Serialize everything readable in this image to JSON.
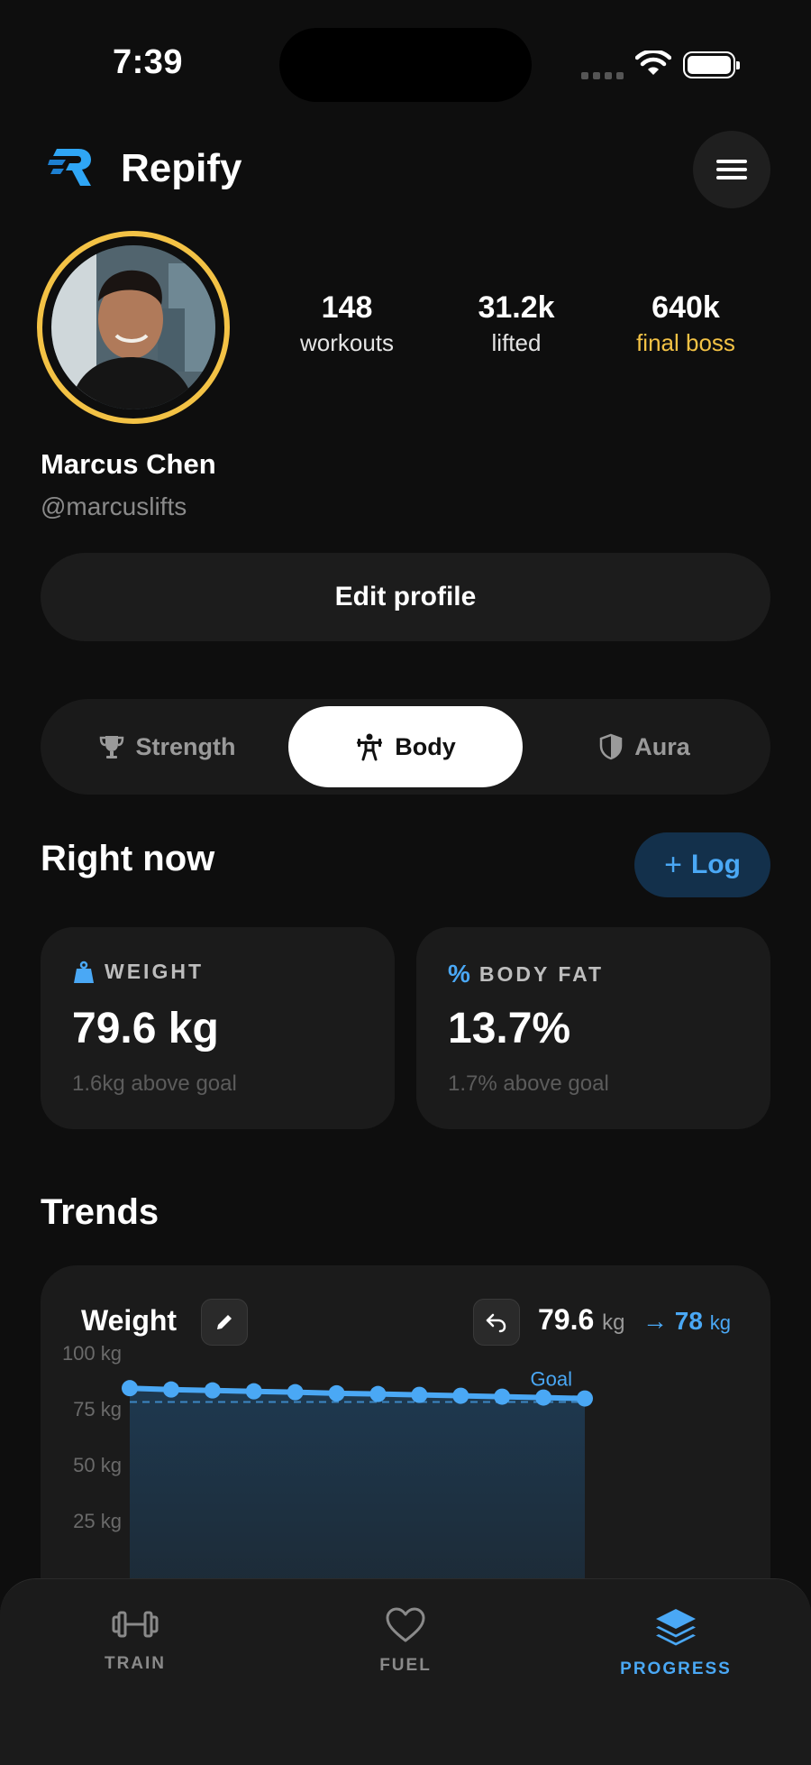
{
  "status_bar": {
    "time": "7:39"
  },
  "header": {
    "app_name": "Repify",
    "logo_icon": "repify-logo-icon",
    "menu_icon": "hamburger-menu-icon"
  },
  "profile": {
    "name": "Marcus Chen",
    "handle": "@marcuslifts",
    "stats": [
      {
        "value": "148",
        "label": "workouts"
      },
      {
        "value": "31.2k",
        "label": "lifted"
      },
      {
        "value": "640k",
        "label": "final boss"
      }
    ],
    "edit_label": "Edit profile"
  },
  "tabs": [
    {
      "label": "Strength",
      "icon": "trophy-icon",
      "active": false
    },
    {
      "label": "Body",
      "icon": "weightlifter-icon",
      "active": true
    },
    {
      "label": "Aura",
      "icon": "shield-icon",
      "active": false
    }
  ],
  "right_now": {
    "title": "Right now",
    "log_label": "Log",
    "cards": [
      {
        "label": "WEIGHT",
        "value": "79.6 kg",
        "sub": "1.6kg above goal",
        "icon": "weight-icon"
      },
      {
        "label": "BODY FAT",
        "value": "13.7%",
        "sub": "1.7% above goal",
        "icon": "percent-icon"
      }
    ]
  },
  "trends": {
    "title": "Trends",
    "card_title": "Weight",
    "current_value": "79.6",
    "current_unit": "kg",
    "goal_value": "78",
    "goal_unit": "kg",
    "goal_label": "Goal",
    "y_ticks": [
      "100 kg",
      "75 kg",
      "50 kg",
      "25 kg"
    ]
  },
  "chart_data": {
    "type": "area",
    "y_ticks": [
      100,
      75,
      50,
      25
    ],
    "goal": 78,
    "values": [
      84.2,
      83.6,
      83.2,
      82.8,
      82.4,
      81.9,
      81.6,
      81.2,
      80.8,
      80.4,
      80.0,
      79.6
    ],
    "colors": {
      "line": "#4aa8f5",
      "fill": "#1e3a52"
    }
  },
  "bottom_nav": [
    {
      "label": "TRAIN",
      "icon": "dumbbell-icon",
      "active": false
    },
    {
      "label": "FUEL",
      "icon": "heart-icon",
      "active": false
    },
    {
      "label": "PROGRESS",
      "icon": "layers-icon",
      "active": true
    }
  ],
  "colors": {
    "accent": "#4aa8f5",
    "gold": "#f3c245",
    "background": "#0e0e0e",
    "card": "#1b1b1b"
  }
}
